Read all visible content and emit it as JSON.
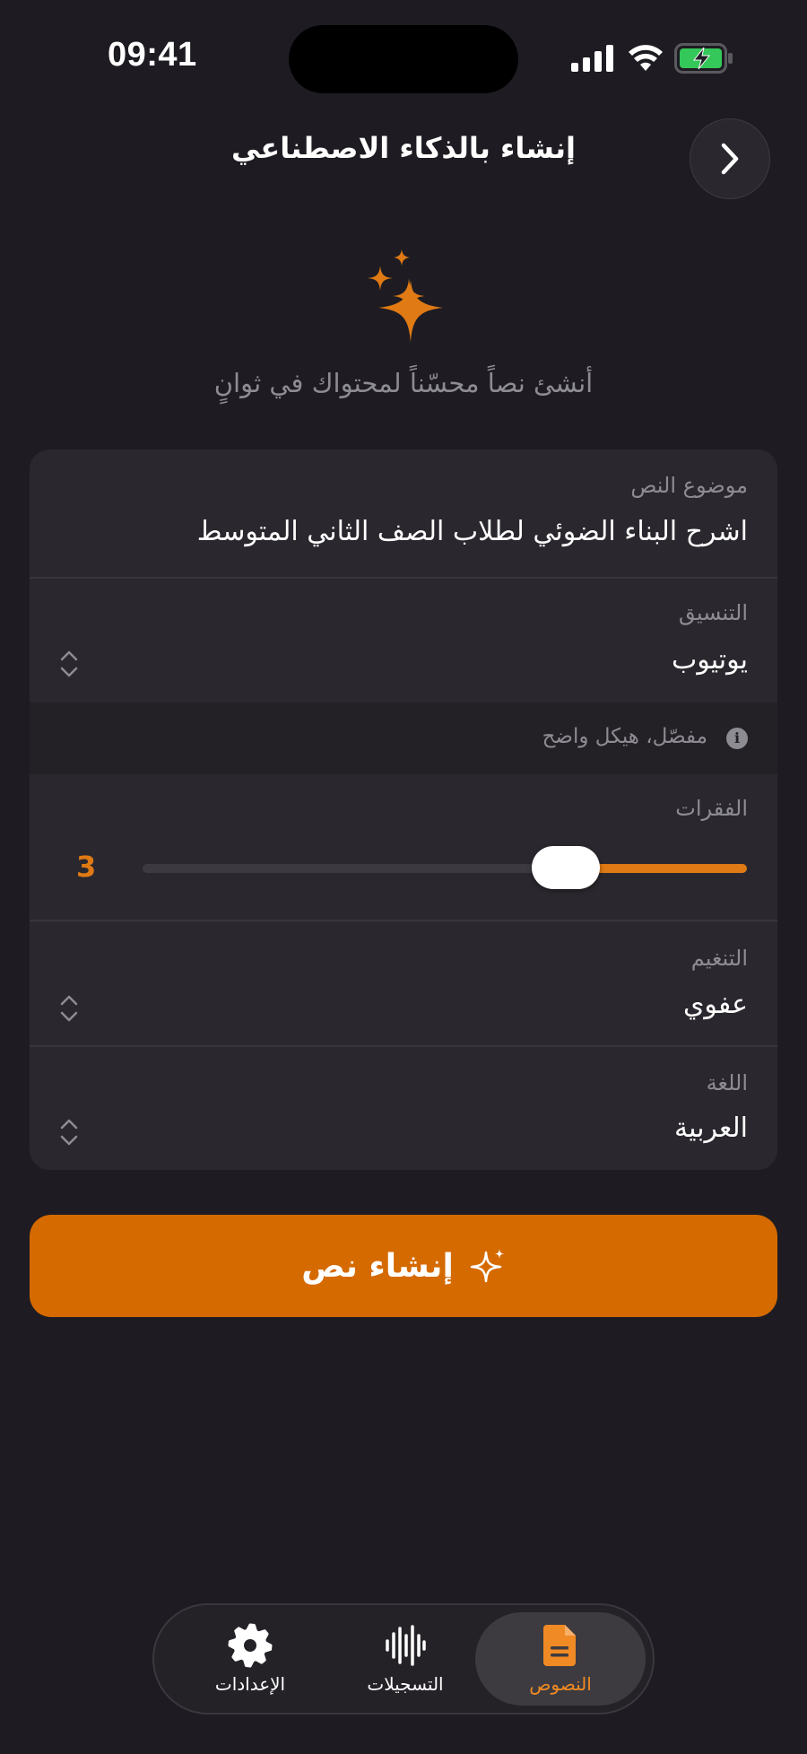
{
  "status_bar": {
    "time": "09:41"
  },
  "header": {
    "title": "إنشاء بالذكاء الاصطناعي",
    "back_icon": "chevron-right-icon"
  },
  "hero": {
    "icon": "sparkles-icon",
    "subtitle": "أنشئ نصاً محسّناً لمحتواك في ثوانٍ"
  },
  "form": {
    "topic": {
      "label": "موضوع النص",
      "value": "اشرح البناء الضوئي لطلاب الصف الثاني المتوسط"
    },
    "format": {
      "label": "التنسيق",
      "value": "يوتيوب"
    },
    "format_hint": "مفصّل، هيكل واضح",
    "paragraphs": {
      "label": "الفقرات",
      "value": "3",
      "fill_fraction": 0.3
    },
    "tone": {
      "label": "التنغيم",
      "value": "عفوي"
    },
    "language": {
      "label": "اللغة",
      "value": "العربية"
    }
  },
  "generate_button": {
    "label": "إنشاء نص",
    "icon": "sparkles-icon"
  },
  "tabs": [
    {
      "label": "النصوص",
      "icon": "document-icon",
      "active": true
    },
    {
      "label": "التسجيلات",
      "icon": "waveform-icon",
      "active": false
    },
    {
      "label": "الإعدادات",
      "icon": "gear-icon",
      "active": false
    }
  ],
  "colors": {
    "accent": "#e07a14",
    "button": "#d56a00",
    "background": "#1e1c22",
    "card": "#2a282e"
  }
}
